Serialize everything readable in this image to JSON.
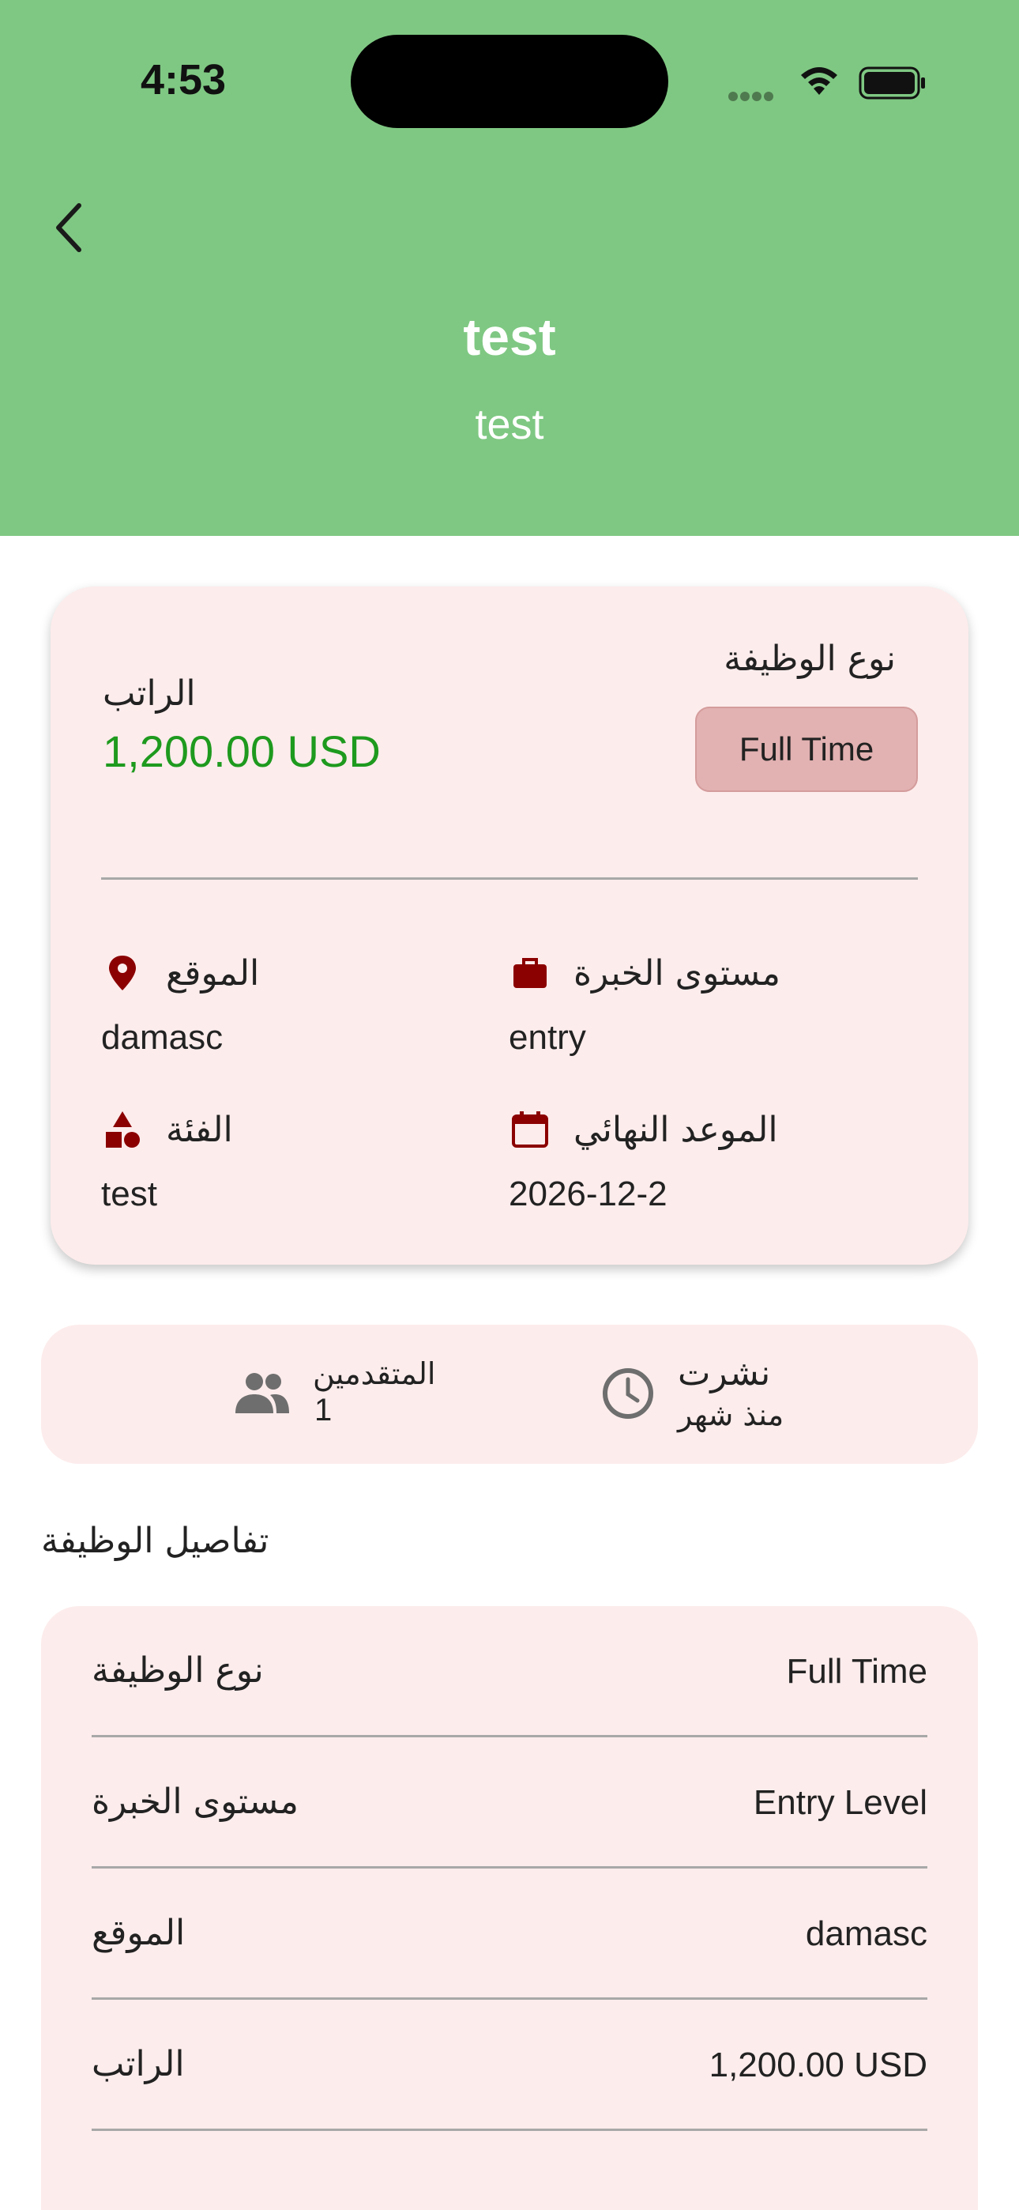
{
  "status_bar": {
    "time": "4:53"
  },
  "header": {
    "title": "test",
    "subtitle": "test",
    "background_color": "#7fc883"
  },
  "overview": {
    "job_type_label": "نوع الوظيفة",
    "job_type_value": "Full Time",
    "salary_label": "الراتب",
    "salary_value": "1,200.00 USD",
    "salary_color": "#1e9a1e",
    "experience_label": "مستوى الخبرة",
    "experience_value": "entry",
    "experience_icon": "briefcase-icon",
    "location_label": "الموقع",
    "location_value": "damasc",
    "location_icon": "location-pin-icon",
    "deadline_label": "الموعد النهائي",
    "deadline_value": "2026-12-2",
    "deadline_icon": "calendar-icon",
    "category_label": "الفئة",
    "category_value": "test",
    "category_icon": "shapes-icon",
    "icon_color": "#8b0000"
  },
  "stats": {
    "published_label": "نشرت",
    "published_value": "منذ شهر",
    "published_icon": "clock-icon",
    "applicants_label": "المتقدمين",
    "applicants_value": "1",
    "applicants_icon": "people-icon"
  },
  "details": {
    "heading": "تفاصيل الوظيفة",
    "rows": [
      {
        "label": "نوع الوظيفة",
        "value": "Full Time"
      },
      {
        "label": "مستوى الخبرة",
        "value": "Entry Level"
      },
      {
        "label": "الموقع",
        "value": "damasc"
      },
      {
        "label": "الراتب",
        "value": "1,200.00 USD"
      }
    ]
  }
}
